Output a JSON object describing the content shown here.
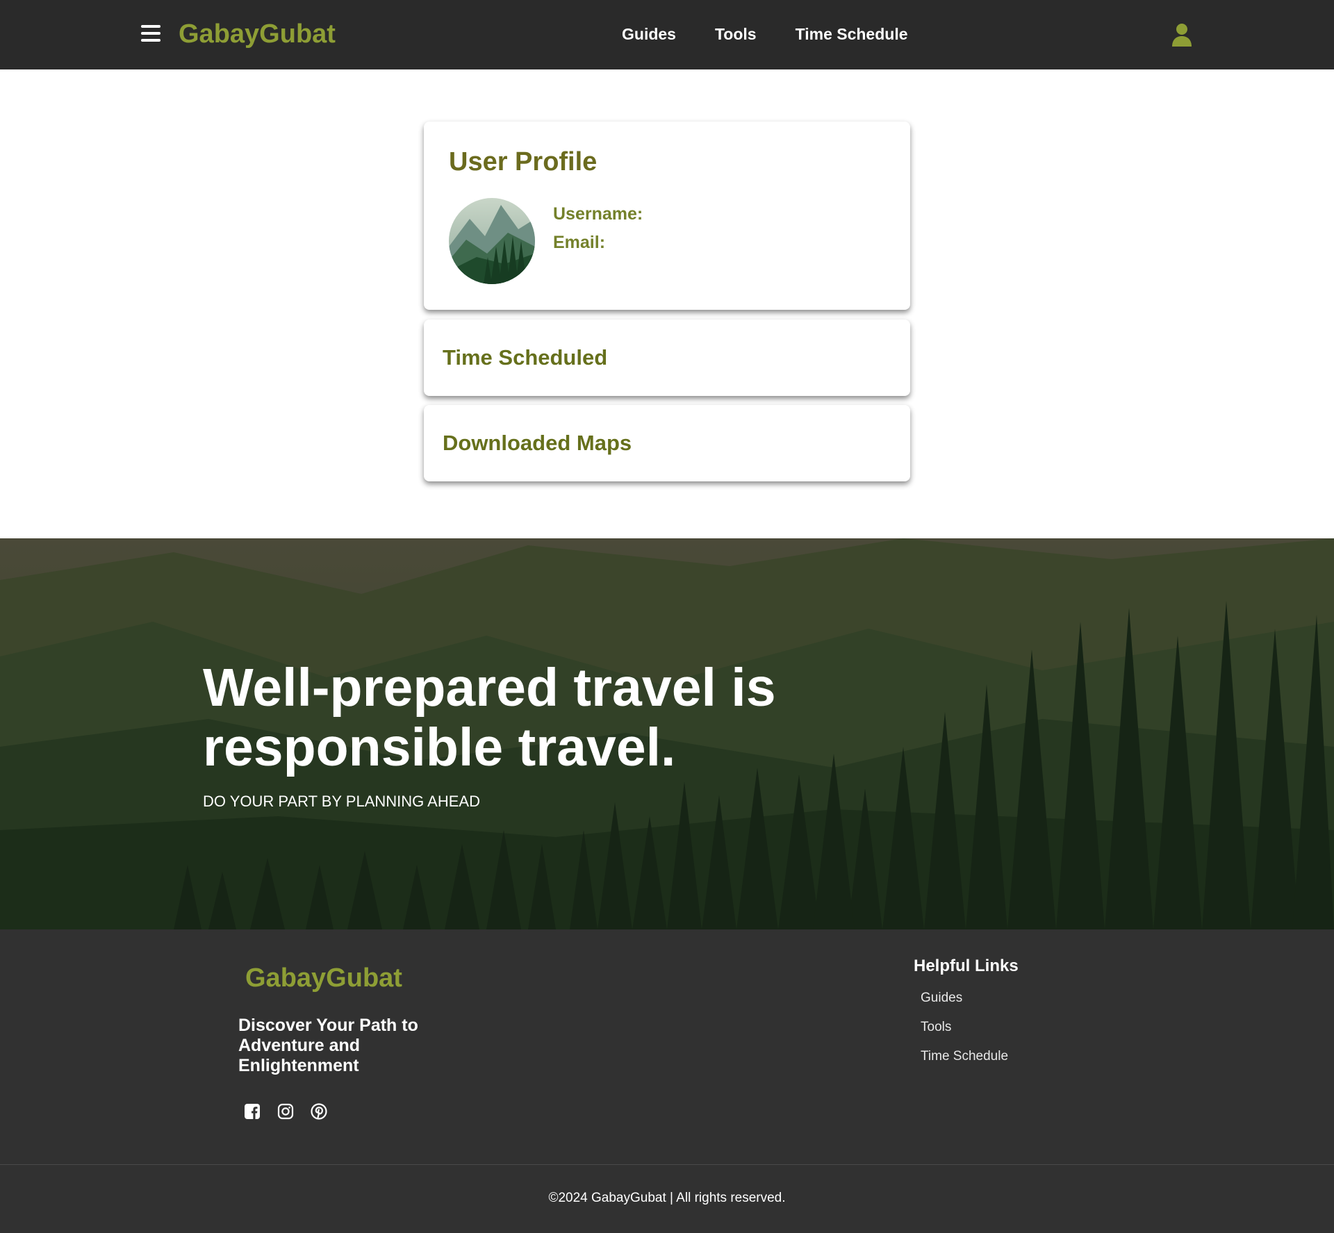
{
  "nav": {
    "brand": "GabayGubat",
    "links": [
      "Guides",
      "Tools",
      "Time Schedule"
    ],
    "menu_icon": "hamburger-icon",
    "account_icon": "user-icon"
  },
  "profile": {
    "title": "User Profile",
    "username_label": "Username:",
    "email_label": "Email:"
  },
  "sections": {
    "time_scheduled": "Time Scheduled",
    "downloaded_maps": "Downloaded Maps"
  },
  "hero": {
    "title": "Well-prepared travel is responsible travel.",
    "subtitle": "DO YOUR PART BY PLANNING AHEAD"
  },
  "footer": {
    "brand": "GabayGubat",
    "tagline": "Discover Your Path to Adventure and Enlightenment",
    "social_icons": [
      "facebook-icon",
      "instagram-icon",
      "pinterest-icon"
    ],
    "helpful_links_title": "Helpful Links",
    "helpful_links": [
      "Guides",
      "Tools",
      "Time Schedule"
    ],
    "copyright": "©2024 GabayGubat | All rights reserved."
  },
  "colors": {
    "accent": "#8e9e35",
    "heading_olive": "#6b6b1e",
    "nav_bg": "#2a2a2a",
    "footer_bg": "#313131"
  }
}
